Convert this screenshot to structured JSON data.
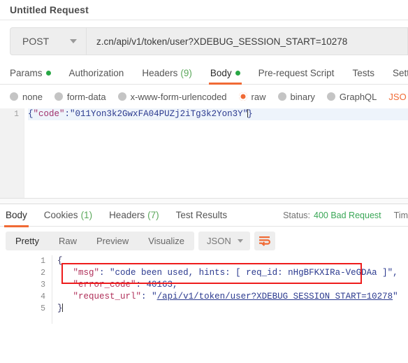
{
  "request": {
    "title": "Untitled Request",
    "method": "POST",
    "method_caret_icon": "chevron-down-icon",
    "url": "z.cn/api/v1/token/user?XDEBUG_SESSION_START=10278",
    "tabs": [
      {
        "label": "Params",
        "dot": true,
        "active": false
      },
      {
        "label": "Authorization",
        "dot": false,
        "active": false
      },
      {
        "label": "Headers",
        "count": "(9)",
        "active": false
      },
      {
        "label": "Body",
        "dot": true,
        "active": true
      },
      {
        "label": "Pre-request Script",
        "active": false
      },
      {
        "label": "Tests",
        "active": false
      },
      {
        "label": "Sett",
        "active": false
      }
    ],
    "body_types": [
      {
        "label": "none",
        "selected": false
      },
      {
        "label": "form-data",
        "selected": false
      },
      {
        "label": "x-www-form-urlencoded",
        "selected": false
      },
      {
        "label": "raw",
        "selected": true
      },
      {
        "label": "binary",
        "selected": false
      },
      {
        "label": "GraphQL",
        "selected": false
      }
    ],
    "body_format": "JSO",
    "editor": {
      "line_number": "1",
      "code_open": "{",
      "code_key": "\"code\"",
      "code_colon": ":",
      "code_value": "\"011Yon3k2GwxFA04PUZj2iTg3k2Yon3Y\"",
      "code_close": "}"
    }
  },
  "response": {
    "tabs": [
      {
        "label": "Body",
        "active": true
      },
      {
        "label": "Cookies",
        "count": "(1)",
        "active": false
      },
      {
        "label": "Headers",
        "count": "(7)",
        "active": false
      },
      {
        "label": "Test Results",
        "active": false
      }
    ],
    "status_label": "Status:",
    "status_value": "400 Bad Request",
    "time_label": "Tim",
    "view_modes": [
      {
        "label": "Pretty",
        "active": true
      },
      {
        "label": "Raw",
        "active": false
      },
      {
        "label": "Preview",
        "active": false
      },
      {
        "label": "Visualize",
        "active": false
      }
    ],
    "format": "JSON",
    "format_caret_icon": "chevron-down-icon",
    "wrap_icon": "word-wrap-icon",
    "line_numbers": [
      "1",
      "2",
      "3",
      "4",
      "5"
    ],
    "body": {
      "l1": "{",
      "l2_key": "\"msg\"",
      "l2_sep": ": ",
      "l2_val": "\"code been used, hints: [ req_id: nHgBFKXIRa-VeGDAa ]\",",
      "l3_key": "\"error_code\"",
      "l3_sep": ": ",
      "l3_val": "40163,",
      "l4_key": "\"request_url\"",
      "l4_sep": ": ",
      "l4_val_quote1": "\"",
      "l4_val_link": "/api/v1/token/user?XDEBUG_SESSION_START=10278",
      "l4_val_quote2": "\"",
      "l5": "}"
    },
    "highlight_color": "#ee1c1c"
  },
  "theme": {
    "accent": "#f06a35",
    "green": "#3aa757",
    "highlight_red": "#ee1c1c"
  }
}
